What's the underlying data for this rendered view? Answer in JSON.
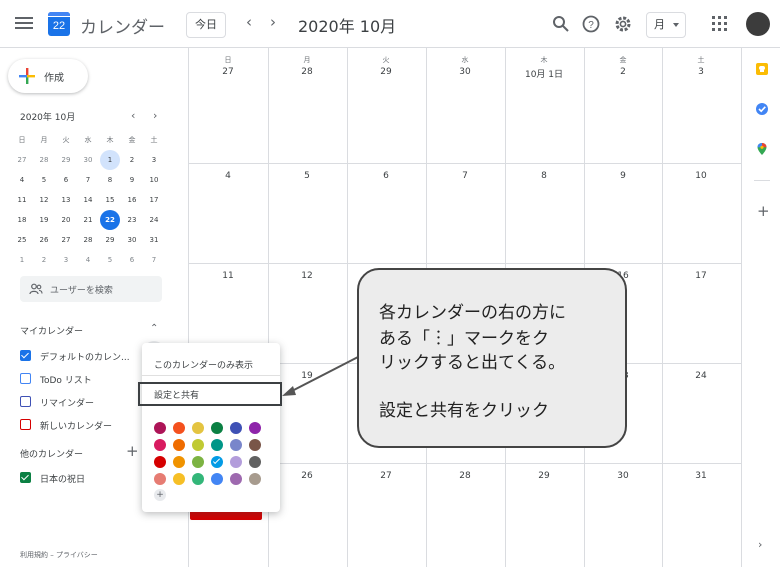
{
  "header": {
    "app_icon_number": "22",
    "app_title": "カレンダー",
    "today_label": "今日",
    "prev_label": "‹",
    "next_label": "›",
    "current_period": "2020年 10月",
    "view_label": "月"
  },
  "sidebar": {
    "create_label": "作成",
    "mini_calendar": {
      "month_label": "2020年 10月",
      "weekdays": [
        "日",
        "月",
        "火",
        "水",
        "木",
        "金",
        "土"
      ],
      "weeks": [
        [
          "27",
          "28",
          "29",
          "30",
          "1",
          "2",
          "3"
        ],
        [
          "4",
          "5",
          "6",
          "7",
          "8",
          "9",
          "10"
        ],
        [
          "11",
          "12",
          "13",
          "14",
          "15",
          "16",
          "17"
        ],
        [
          "18",
          "19",
          "20",
          "21",
          "22",
          "23",
          "24"
        ],
        [
          "25",
          "26",
          "27",
          "28",
          "29",
          "30",
          "31"
        ],
        [
          "1",
          "2",
          "3",
          "4",
          "5",
          "6",
          "7"
        ]
      ],
      "selected_day": "1",
      "today_day": "22"
    },
    "user_search_placeholder": "ユーザーを検索",
    "my_calendars": {
      "title": "マイカレンダー",
      "items": [
        {
          "label": "デフォルトのカレン...",
          "checked": true,
          "color": "#1a73e8"
        },
        {
          "label": "ToDo リスト",
          "checked": false,
          "color": "#4285f4"
        },
        {
          "label": "リマインダー",
          "checked": false,
          "color": "#3f51b5"
        },
        {
          "label": "新しいカレンダー",
          "checked": false,
          "color": "#d50000"
        }
      ]
    },
    "other_calendars": {
      "title": "他のカレンダー",
      "items": [
        {
          "label": "日本の祝日",
          "checked": true,
          "color": "#0b8043"
        }
      ]
    },
    "footer": "利用規約 – プライバシー"
  },
  "month_view": {
    "weekdays": [
      "日",
      "月",
      "火",
      "水",
      "木",
      "金",
      "土"
    ],
    "weeks": [
      [
        "27",
        "28",
        "29",
        "30",
        "10月 1日",
        "2",
        "3"
      ],
      [
        "4",
        "5",
        "6",
        "7",
        "8",
        "9",
        "10"
      ],
      [
        "11",
        "12",
        "",
        "",
        "",
        "16",
        "17"
      ],
      [
        "",
        "19",
        "",
        "",
        "",
        "23",
        "24"
      ],
      [
        "",
        "26",
        "27",
        "28",
        "29",
        "30",
        "31"
      ]
    ],
    "event_color": "#d50000"
  },
  "popup_menu": {
    "display_only_label": "このカレンダーのみ表示",
    "settings_label": "設定と共有",
    "colors": [
      [
        "#ad1457",
        "#f4511e",
        "#e4c441",
        "#0b8043",
        "#3f51b5",
        "#8e24aa"
      ],
      [
        "#d81b60",
        "#ef6c00",
        "#c0ca33",
        "#009688",
        "#7986cb",
        "#795548"
      ],
      [
        "#d50000",
        "#f09300",
        "#7cb342",
        "#039be5",
        "#b39ddb",
        "#616161"
      ],
      [
        "#e67c73",
        "#f6bf26",
        "#33b679",
        "#4285f4",
        "#9e69af",
        "#a79b8e"
      ]
    ],
    "selected_color": "#039be5",
    "add_color_symbol": "+"
  },
  "side_panel": {
    "icons": [
      "keep-icon",
      "tasks-icon",
      "maps-icon"
    ],
    "add_symbol": "+",
    "expand_symbol": "›"
  },
  "annotation": {
    "lines": [
      "各カレンダーの右の方に",
      "ある「︙」マークをク",
      "リックすると出てくる。",
      "",
      "設定と共有をクリック"
    ]
  }
}
